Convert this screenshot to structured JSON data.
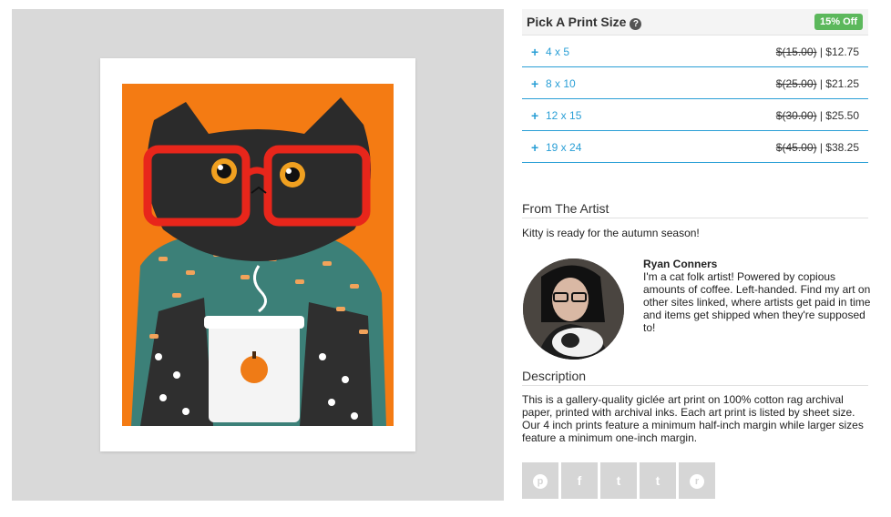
{
  "print_size": {
    "title": "Pick A Print Size",
    "help_glyph": "?",
    "badge": "15% Off",
    "options": [
      {
        "label": "4 x 5",
        "old_price": "$(15.00)",
        "separator": " | ",
        "price": "$12.75"
      },
      {
        "label": "8 x 10",
        "old_price": "$(25.00)",
        "separator": " | ",
        "price": "$21.25"
      },
      {
        "label": "12 x 15",
        "old_price": "$(30.00)",
        "separator": " | ",
        "price": "$25.50"
      },
      {
        "label": "19 x 24",
        "old_price": "$(45.00)",
        "separator": " | ",
        "price": "$38.25"
      }
    ],
    "plus_glyph": "+"
  },
  "artist": {
    "section_title": "From The Artist",
    "tagline": "Kitty is ready for the autumn season!",
    "name": "Ryan Conners",
    "bio": "I'm a cat folk artist! Powered by copious amounts of coffee. Left-handed. Find my art on other sites linked, where artists get paid in time and items get shipped when they're supposed to!"
  },
  "description": {
    "section_title": "Description",
    "text": "This is a gallery-quality giclée art print on 100% cotton rag archival paper, printed with archival inks. Each art print is listed by sheet size. Our 4 inch prints feature a minimum half-inch margin while larger sizes feature a minimum one-inch margin."
  },
  "share": [
    {
      "icon": "pinterest-icon",
      "glyph": "p"
    },
    {
      "icon": "facebook-icon",
      "glyph": "f"
    },
    {
      "icon": "twitter-icon",
      "glyph": "t"
    },
    {
      "icon": "tumblr-icon",
      "glyph": "t"
    },
    {
      "icon": "reddit-icon",
      "glyph": "r"
    }
  ],
  "colors": {
    "accent": "#2a9fd6",
    "badge": "#5cb85c",
    "art_background": "#f47b13",
    "gallery_background": "#d9d9d9",
    "share_button": "#d6d6d6"
  }
}
